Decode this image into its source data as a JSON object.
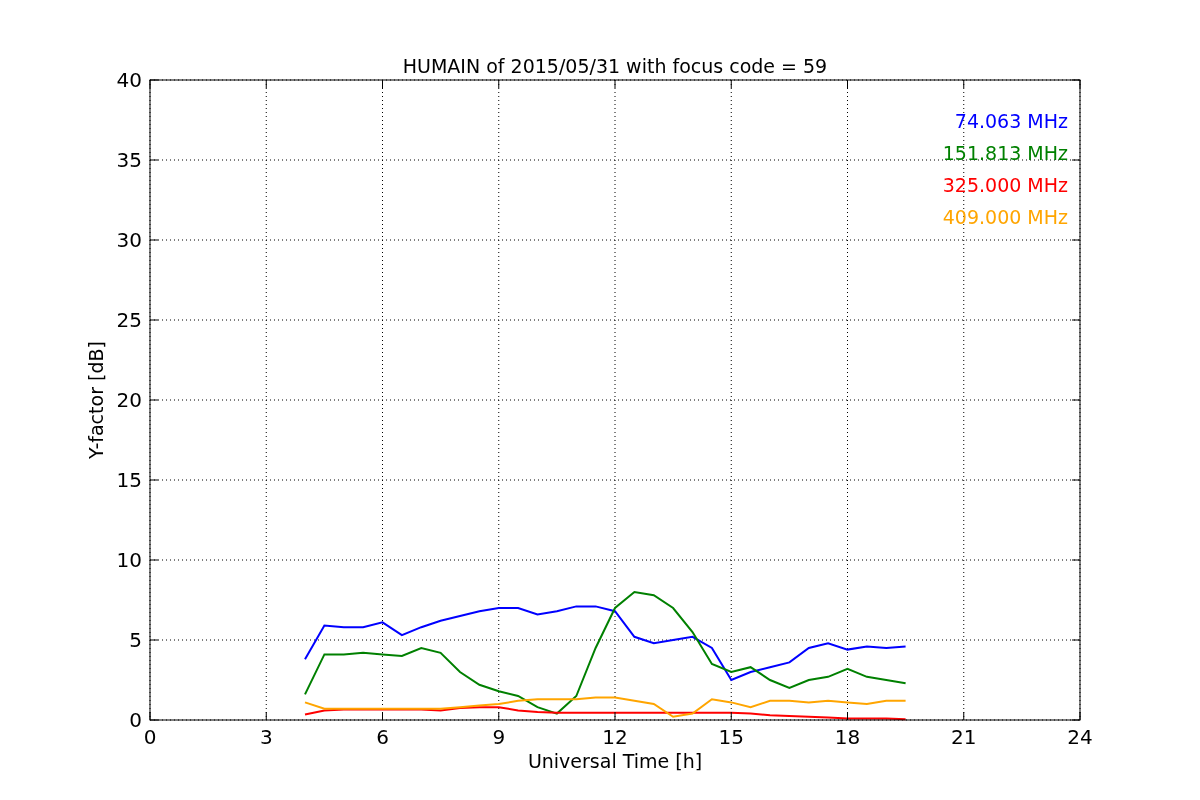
{
  "chart_data": {
    "type": "line",
    "title": "HUMAIN of 2015/05/31 with focus code = 59",
    "xlabel": "Universal Time [h]",
    "ylabel": "Y-factor [dB]",
    "x": [
      4,
      4.5,
      5,
      5.5,
      6,
      6.5,
      7,
      7.5,
      8,
      8.5,
      9,
      9.5,
      10,
      10.5,
      11,
      11.5,
      12,
      12.5,
      13,
      13.5,
      14,
      14.5,
      15,
      15.5,
      16,
      16.5,
      17,
      17.5,
      18,
      18.5,
      19,
      19.5
    ],
    "series": [
      {
        "name": "74.063 MHz",
        "color": "#0000ff",
        "values": [
          3.8,
          5.9,
          5.8,
          5.8,
          6.1,
          5.3,
          5.8,
          6.2,
          6.5,
          6.8,
          7.0,
          7.0,
          6.6,
          6.8,
          7.1,
          7.1,
          6.8,
          5.2,
          4.8,
          5.0,
          5.2,
          4.5,
          2.5,
          3.0,
          3.3,
          3.6,
          4.5,
          4.8,
          4.4,
          4.6,
          4.5,
          4.6
        ]
      },
      {
        "name": "151.813 MHz",
        "color": "#008000",
        "values": [
          1.6,
          4.1,
          4.1,
          4.2,
          4.1,
          4.0,
          4.5,
          4.2,
          3.0,
          2.2,
          1.8,
          1.5,
          0.8,
          0.4,
          1.5,
          4.5,
          7.0,
          8.0,
          7.8,
          7.0,
          5.5,
          3.5,
          3.0,
          3.3,
          2.5,
          2.0,
          2.5,
          2.7,
          3.2,
          2.7,
          2.5,
          2.3
        ]
      },
      {
        "name": "325.000 MHz",
        "color": "#ff0000",
        "values": [
          0.35,
          0.6,
          0.65,
          0.65,
          0.65,
          0.65,
          0.65,
          0.6,
          0.75,
          0.8,
          0.8,
          0.6,
          0.5,
          0.45,
          0.45,
          0.45,
          0.45,
          0.45,
          0.45,
          0.45,
          0.45,
          0.45,
          0.45,
          0.4,
          0.3,
          0.25,
          0.2,
          0.15,
          0.1,
          0.1,
          0.1,
          0.05
        ]
      },
      {
        "name": "409.000 MHz",
        "color": "#ffa500",
        "values": [
          1.1,
          0.7,
          0.7,
          0.7,
          0.7,
          0.7,
          0.7,
          0.7,
          0.8,
          0.9,
          1.0,
          1.2,
          1.3,
          1.3,
          1.3,
          1.4,
          1.4,
          1.2,
          1.0,
          0.2,
          0.4,
          1.3,
          1.1,
          0.8,
          1.2,
          1.2,
          1.1,
          1.2,
          1.1,
          1.0,
          1.2,
          1.2
        ]
      }
    ],
    "xlim": [
      0,
      24
    ],
    "ylim": [
      0,
      40
    ],
    "grid": true,
    "xticks": [
      0,
      3,
      6,
      9,
      12,
      15,
      18,
      21,
      24
    ],
    "yticks": [
      0,
      5,
      10,
      15,
      20,
      25,
      30,
      35,
      40
    ]
  }
}
